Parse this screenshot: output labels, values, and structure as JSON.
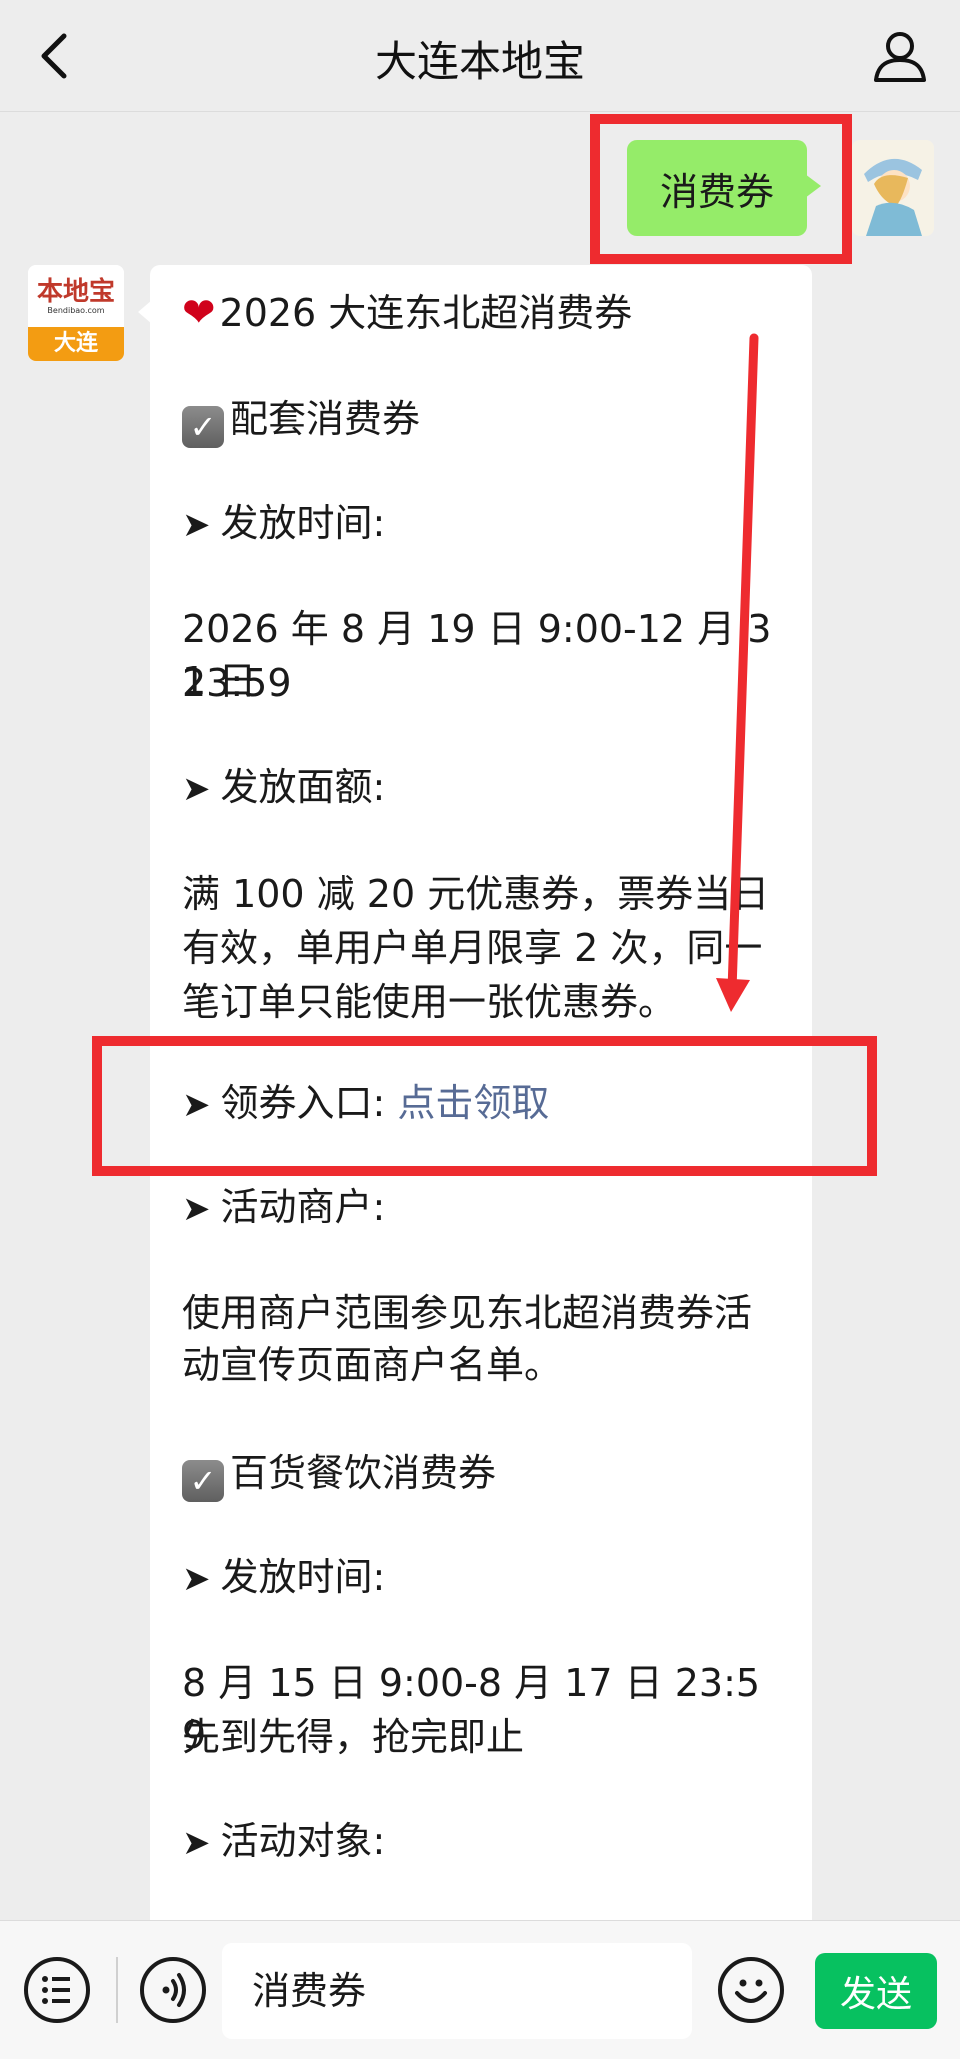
{
  "header": {
    "title": "大连本地宝"
  },
  "outgoing": {
    "text": "消费券"
  },
  "bot": {
    "logo_main": "本地宝",
    "logo_url": "Bendibao.com",
    "logo_city": "大连"
  },
  "message": {
    "title": "2026 大连东北超消费券",
    "section1": "配套消费券",
    "label_time": "发放时间:",
    "time1_a": "2026 年 8 月 19 日 9:00-12 月 31 日",
    "time1_b": "23:59",
    "label_amount": "发放面额:",
    "amount_text": "满 100 减 20 元优惠券，票券当日有效，单用户单月限享 2 次，同一笔订单只能使用一张优惠券。",
    "label_entry": "领券入口:",
    "entry_link": "点击领取",
    "label_merchants": "活动商户:",
    "merchants_text": "使用商户范围参见东北超消费券活动宣传页面商户名单。",
    "section2": "百货餐饮消费券",
    "label_time2": "发放时间:",
    "time2_a": "8 月 15 日 9:00-8 月 17 日 23:59",
    "time2_b": "先到先得，抢完即止",
    "label_target": "活动对象:"
  },
  "inputbar": {
    "input_value": "消费券",
    "send_label": "发送"
  },
  "colors": {
    "accent_green": "#07c160",
    "bubble_green": "#95ec69",
    "annotation_red": "#ee2b2f",
    "link_blue": "#576b95"
  }
}
